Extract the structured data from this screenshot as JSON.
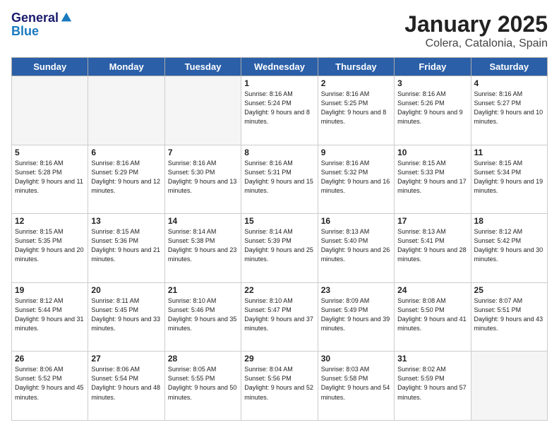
{
  "header": {
    "logo_general": "General",
    "logo_blue": "Blue",
    "title": "January 2025",
    "subtitle": "Colera, Catalonia, Spain"
  },
  "weekdays": [
    "Sunday",
    "Monday",
    "Tuesday",
    "Wednesday",
    "Thursday",
    "Friday",
    "Saturday"
  ],
  "weeks": [
    [
      {
        "day": "",
        "empty": true
      },
      {
        "day": "",
        "empty": true
      },
      {
        "day": "",
        "empty": true
      },
      {
        "day": "1",
        "sunrise": "8:16 AM",
        "sunset": "5:24 PM",
        "daylight": "9 hours and 8 minutes."
      },
      {
        "day": "2",
        "sunrise": "8:16 AM",
        "sunset": "5:25 PM",
        "daylight": "9 hours and 8 minutes."
      },
      {
        "day": "3",
        "sunrise": "8:16 AM",
        "sunset": "5:26 PM",
        "daylight": "9 hours and 9 minutes."
      },
      {
        "day": "4",
        "sunrise": "8:16 AM",
        "sunset": "5:27 PM",
        "daylight": "9 hours and 10 minutes."
      }
    ],
    [
      {
        "day": "5",
        "sunrise": "8:16 AM",
        "sunset": "5:28 PM",
        "daylight": "9 hours and 11 minutes."
      },
      {
        "day": "6",
        "sunrise": "8:16 AM",
        "sunset": "5:29 PM",
        "daylight": "9 hours and 12 minutes."
      },
      {
        "day": "7",
        "sunrise": "8:16 AM",
        "sunset": "5:30 PM",
        "daylight": "9 hours and 13 minutes."
      },
      {
        "day": "8",
        "sunrise": "8:16 AM",
        "sunset": "5:31 PM",
        "daylight": "9 hours and 15 minutes."
      },
      {
        "day": "9",
        "sunrise": "8:16 AM",
        "sunset": "5:32 PM",
        "daylight": "9 hours and 16 minutes."
      },
      {
        "day": "10",
        "sunrise": "8:15 AM",
        "sunset": "5:33 PM",
        "daylight": "9 hours and 17 minutes."
      },
      {
        "day": "11",
        "sunrise": "8:15 AM",
        "sunset": "5:34 PM",
        "daylight": "9 hours and 19 minutes."
      }
    ],
    [
      {
        "day": "12",
        "sunrise": "8:15 AM",
        "sunset": "5:35 PM",
        "daylight": "9 hours and 20 minutes."
      },
      {
        "day": "13",
        "sunrise": "8:15 AM",
        "sunset": "5:36 PM",
        "daylight": "9 hours and 21 minutes."
      },
      {
        "day": "14",
        "sunrise": "8:14 AM",
        "sunset": "5:38 PM",
        "daylight": "9 hours and 23 minutes."
      },
      {
        "day": "15",
        "sunrise": "8:14 AM",
        "sunset": "5:39 PM",
        "daylight": "9 hours and 25 minutes."
      },
      {
        "day": "16",
        "sunrise": "8:13 AM",
        "sunset": "5:40 PM",
        "daylight": "9 hours and 26 minutes."
      },
      {
        "day": "17",
        "sunrise": "8:13 AM",
        "sunset": "5:41 PM",
        "daylight": "9 hours and 28 minutes."
      },
      {
        "day": "18",
        "sunrise": "8:12 AM",
        "sunset": "5:42 PM",
        "daylight": "9 hours and 30 minutes."
      }
    ],
    [
      {
        "day": "19",
        "sunrise": "8:12 AM",
        "sunset": "5:44 PM",
        "daylight": "9 hours and 31 minutes."
      },
      {
        "day": "20",
        "sunrise": "8:11 AM",
        "sunset": "5:45 PM",
        "daylight": "9 hours and 33 minutes."
      },
      {
        "day": "21",
        "sunrise": "8:10 AM",
        "sunset": "5:46 PM",
        "daylight": "9 hours and 35 minutes."
      },
      {
        "day": "22",
        "sunrise": "8:10 AM",
        "sunset": "5:47 PM",
        "daylight": "9 hours and 37 minutes."
      },
      {
        "day": "23",
        "sunrise": "8:09 AM",
        "sunset": "5:49 PM",
        "daylight": "9 hours and 39 minutes."
      },
      {
        "day": "24",
        "sunrise": "8:08 AM",
        "sunset": "5:50 PM",
        "daylight": "9 hours and 41 minutes."
      },
      {
        "day": "25",
        "sunrise": "8:07 AM",
        "sunset": "5:51 PM",
        "daylight": "9 hours and 43 minutes."
      }
    ],
    [
      {
        "day": "26",
        "sunrise": "8:06 AM",
        "sunset": "5:52 PM",
        "daylight": "9 hours and 45 minutes."
      },
      {
        "day": "27",
        "sunrise": "8:06 AM",
        "sunset": "5:54 PM",
        "daylight": "9 hours and 48 minutes."
      },
      {
        "day": "28",
        "sunrise": "8:05 AM",
        "sunset": "5:55 PM",
        "daylight": "9 hours and 50 minutes."
      },
      {
        "day": "29",
        "sunrise": "8:04 AM",
        "sunset": "5:56 PM",
        "daylight": "9 hours and 52 minutes."
      },
      {
        "day": "30",
        "sunrise": "8:03 AM",
        "sunset": "5:58 PM",
        "daylight": "9 hours and 54 minutes."
      },
      {
        "day": "31",
        "sunrise": "8:02 AM",
        "sunset": "5:59 PM",
        "daylight": "9 hours and 57 minutes."
      },
      {
        "day": "",
        "empty": true
      }
    ]
  ]
}
